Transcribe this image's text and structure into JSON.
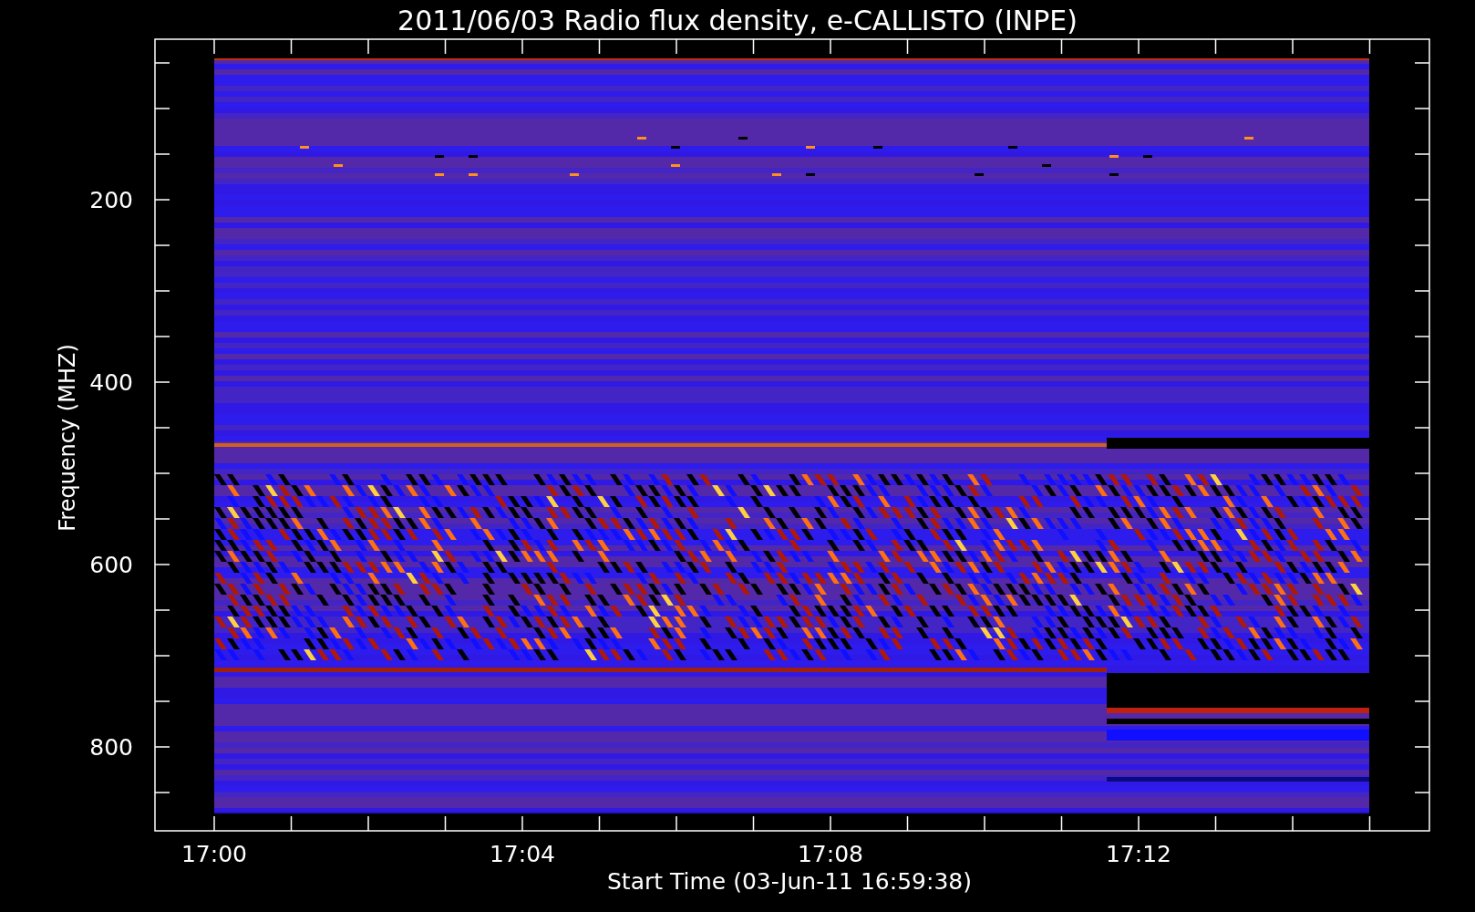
{
  "title": "2011/06/03  Radio flux density, e-CALLISTO (INPE)",
  "y_axis": {
    "label": "Frequency (MHZ)",
    "ticks": [
      "200",
      "400",
      "600",
      "800"
    ]
  },
  "x_axis": {
    "label": "Start Time (03-Jun-11 16:59:38)",
    "ticks": [
      "17:00",
      "17:04",
      "17:08",
      "17:12"
    ]
  }
}
